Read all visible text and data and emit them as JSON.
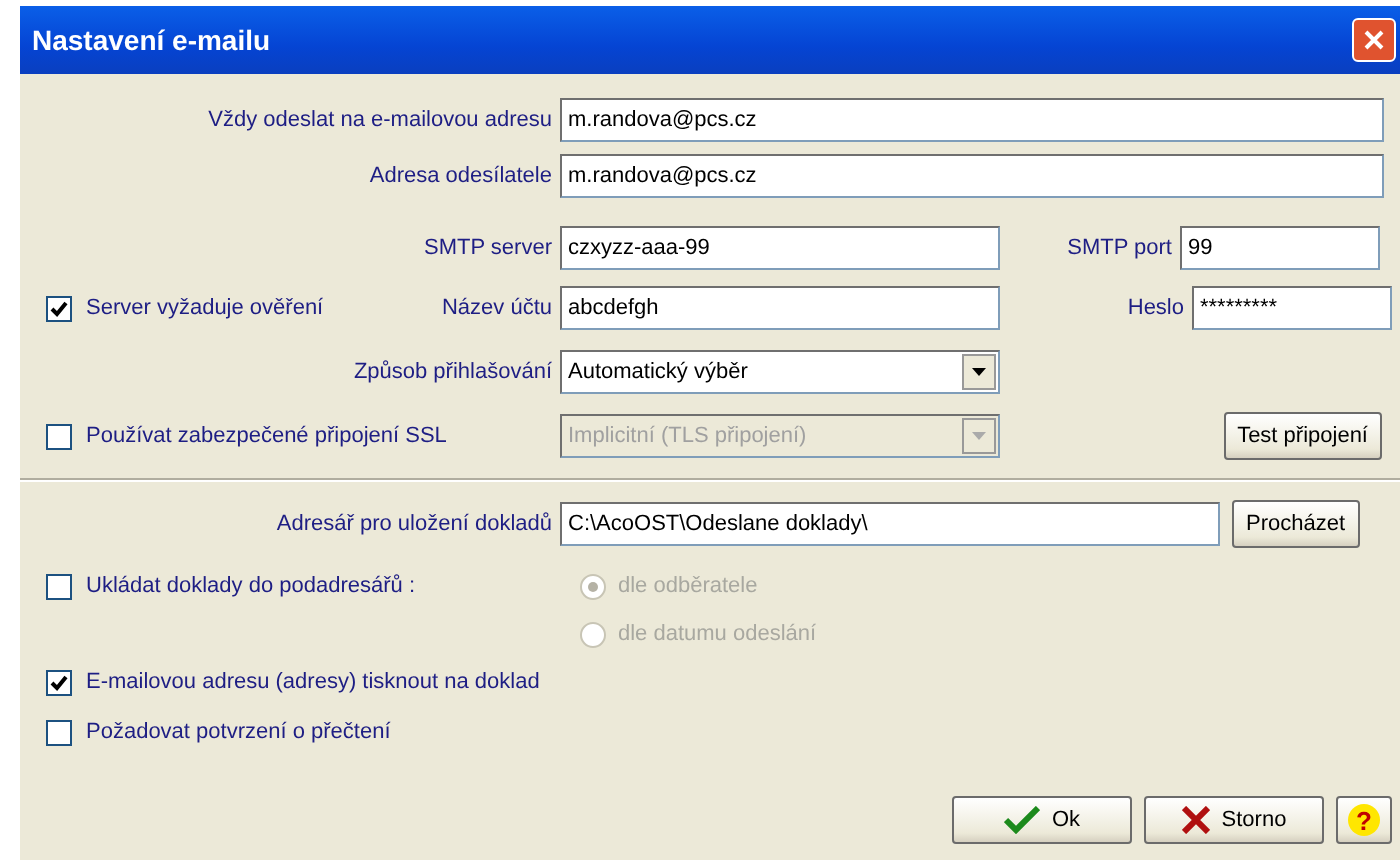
{
  "window": {
    "title": "Nastavení e-mailu"
  },
  "always_send_to": {
    "label": "Vždy odeslat na e-mailovou adresu",
    "value": "m.randova@pcs.cz"
  },
  "sender": {
    "label": "Adresa odesílatele",
    "value": "m.randova@pcs.cz"
  },
  "smtp_server": {
    "label": "SMTP server",
    "value": "czxyzz-aaa-99"
  },
  "smtp_port": {
    "label": "SMTP port",
    "value": "99"
  },
  "auth": {
    "label": "Server vyžaduje ověření",
    "checked": true
  },
  "account": {
    "label": "Název účtu",
    "value": "abcdefgh"
  },
  "password": {
    "label": "Heslo",
    "value": "*********"
  },
  "login_method": {
    "label": "Způsob přihlašování",
    "value": "Automatický výběr",
    "disabled": false
  },
  "ssl": {
    "label": "Používat zabezpečené připojení SSL",
    "checked": false
  },
  "ssl_mode": {
    "value": "Implicitní (TLS připojení)",
    "disabled": true
  },
  "test_button": "Test připojení",
  "folder": {
    "label": "Adresář pro uložení dokladů",
    "value": "C:\\AcoOST\\Odeslane doklady\\"
  },
  "browse_button": "Procházet",
  "subfolders": {
    "label": "Ukládat doklady do podadresářů :",
    "checked": false,
    "options": [
      {
        "label": "dle odběratele",
        "selected": true,
        "disabled": true
      },
      {
        "label": "dle datumu odeslání",
        "selected": false,
        "disabled": true
      }
    ]
  },
  "print_address": {
    "label": "E-mailovou adresu (adresy) tisknout na doklad",
    "checked": true
  },
  "read_receipt": {
    "label": "Požadovat potvrzení o přečtení",
    "checked": false
  },
  "buttons": [
    {
      "kind": "ok",
      "label": "Ok"
    },
    {
      "kind": "cancel",
      "label": "Storno"
    },
    {
      "kind": "help",
      "label": "?"
    }
  ]
}
